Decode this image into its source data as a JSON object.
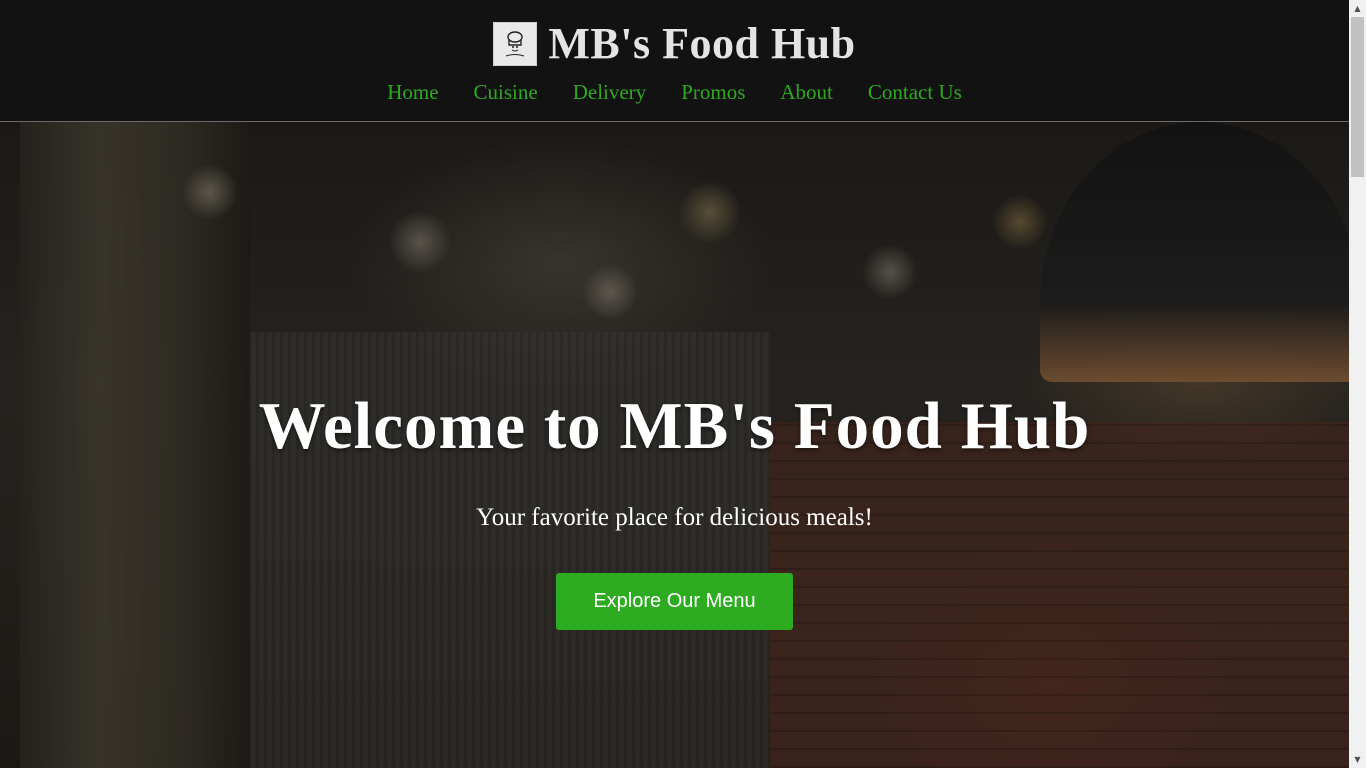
{
  "header": {
    "title": "MB's Food Hub",
    "logo_icon": "chef-logo-icon"
  },
  "nav": {
    "items": [
      {
        "label": "Home"
      },
      {
        "label": "Cuisine"
      },
      {
        "label": "Delivery"
      },
      {
        "label": "Promos"
      },
      {
        "label": "About"
      },
      {
        "label": "Contact Us"
      }
    ]
  },
  "hero": {
    "title": "Welcome to MB's Food Hub",
    "subtitle": "Your favorite place for delicious meals!",
    "cta_label": "Explore Our Menu"
  },
  "colors": {
    "header_bg": "#121212",
    "nav_link": "#2eaa21",
    "accent_button": "#2eac21",
    "title_text": "#e4e4e4"
  }
}
